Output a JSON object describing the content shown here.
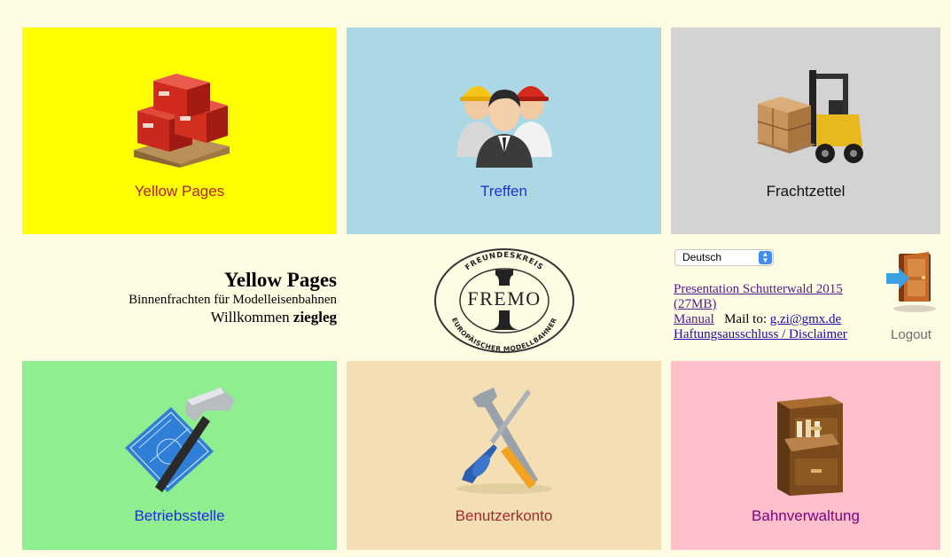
{
  "tiles": {
    "yellow_pages": {
      "label": "Yellow Pages",
      "bg": "#ffff00",
      "label_color": "#b8231b",
      "icon": "boxes-on-pallet-icon"
    },
    "treffen": {
      "label": "Treffen",
      "bg": "#acd8e6",
      "label_color": "#1f2ee0",
      "icon": "people-icon"
    },
    "frachtzettel": {
      "label": "Frachtzettel",
      "bg": "#d3d3d3",
      "label_color": "#111111",
      "icon": "forklift-icon"
    },
    "betriebsstelle": {
      "label": "Betriebsstelle",
      "bg": "#8fee8f",
      "label_color": "#1f2ee0",
      "icon": "hammer-blueprint-icon"
    },
    "benutzerkonto": {
      "label": "Benutzerkonto",
      "bg": "#f4deb3",
      "label_color": "#a52a2a",
      "icon": "tools-icon"
    },
    "bahnverwaltung": {
      "label": "Bahnverwaltung",
      "bg": "#ffc0cb",
      "label_color": "#800080",
      "icon": "file-cabinet-icon"
    }
  },
  "info": {
    "title": "Yellow Pages",
    "subtitle": "Binnenfrachten für Modelleisenbahnen",
    "welcome_prefix": "Willkommen",
    "username": "ziegleg"
  },
  "logo": {
    "top_text": "FREUNDESKREIS",
    "center_text": "FREMO",
    "bottom_text": "EUROPÄISCHER MODELLBAHNER"
  },
  "language": {
    "selected": "Deutsch"
  },
  "links": {
    "presentation": "Presentation Schutterwald 2015 (27MB)",
    "manual": "Manual",
    "mail_prefix": "Mail to:",
    "mail": "g.zi@gmx.de",
    "disclaimer": "Haftungsausschluss / Disclaimer"
  },
  "logout": {
    "label": "Logout",
    "icon": "door-exit-icon"
  },
  "colors": {
    "page_bg": "#fefce3",
    "link": "#1a0dab",
    "link_visited": "#551a8b"
  }
}
